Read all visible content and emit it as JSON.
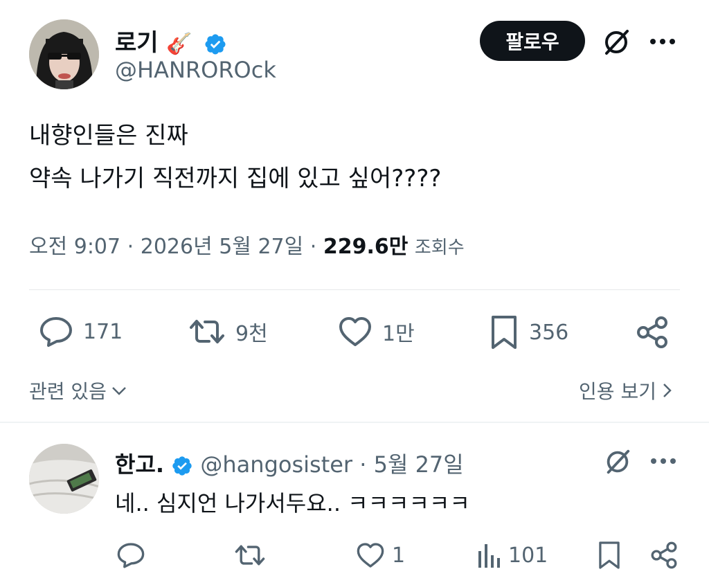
{
  "tweet": {
    "author_name": "로기",
    "name_emoji": "🎸",
    "handle": "@HANROROck",
    "follow_label": "팔로우",
    "text_line1": "내향인들은 진짜",
    "text_line2": "약속 나가기 직전까지 집에 있고 싶어????",
    "time": "오전 9:07",
    "date": "2026년 5월 27일",
    "views_count": "229.6만",
    "views_label": "조회수",
    "replies": "171",
    "retweets": "9천",
    "likes": "1만",
    "bookmarks": "356",
    "related_label": "관련 있음",
    "quotes_label": "인용 보기"
  },
  "reply": {
    "author_name": "한고.",
    "handle": "@hangosister",
    "date": "5월 27일",
    "text": "네.. 심지언 나가서두요.. ㅋㅋㅋㅋㅋㅋ",
    "likes": "1",
    "views": "101"
  },
  "colors": {
    "verified": "#1d9bf0",
    "text": "#0f1419",
    "muted": "#536471"
  },
  "icons": [
    "verified-badge-icon",
    "grok-icon",
    "more-icon",
    "reply-icon",
    "retweet-icon",
    "like-icon",
    "bookmark-icon",
    "share-icon",
    "views-icon",
    "chevron-down-icon",
    "chevron-right-icon"
  ]
}
